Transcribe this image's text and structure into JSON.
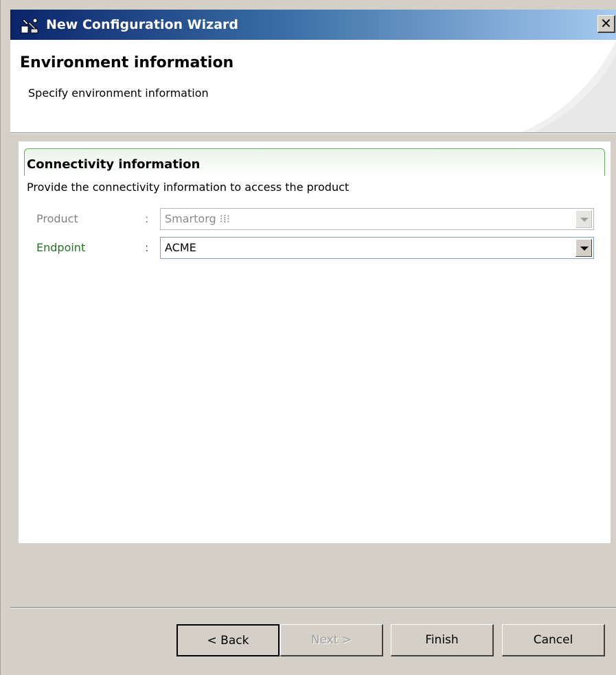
{
  "window": {
    "title": "New Configuration Wizard",
    "close_label": "✕",
    "title_icon": "wizard-icon"
  },
  "banner": {
    "title": "Environment information",
    "subtitle": "Specify environment information"
  },
  "section": {
    "title": "Connectivity information",
    "description": "Provide the connectivity information to access the product"
  },
  "fields": {
    "product": {
      "label": "Product",
      "colon": ":",
      "value": "Smartorg ⁝⁞⁝",
      "enabled": false
    },
    "endpoint": {
      "label": "Endpoint",
      "colon": ":",
      "value": "ACME",
      "enabled": true
    }
  },
  "buttons": {
    "back": "< Back",
    "next": "Next >",
    "finish": "Finish",
    "cancel": "Cancel"
  },
  "colors": {
    "titlebar_start": "#0a246a",
    "titlebar_end": "#a6caf0",
    "endpoint_label": "#1e7a1e",
    "section_border": "#6aa86a"
  }
}
